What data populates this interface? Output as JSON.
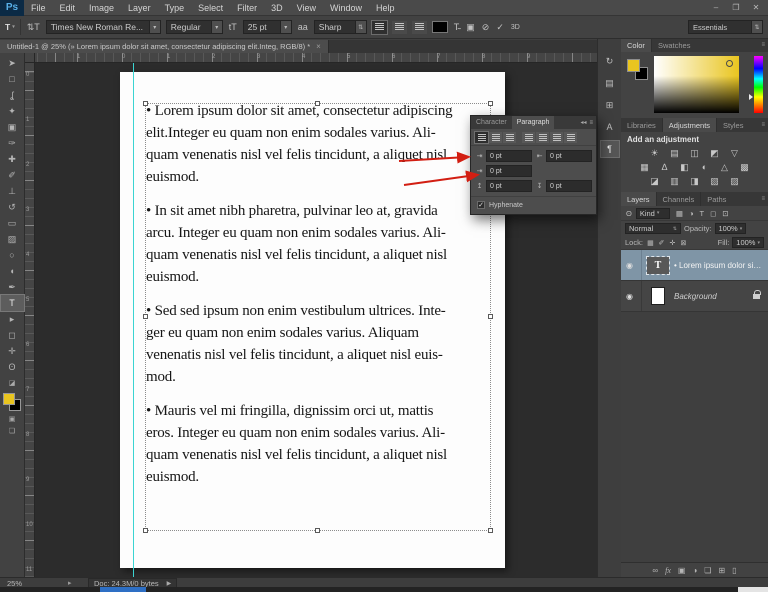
{
  "window": {
    "minimize": "–",
    "restore": "❐",
    "close": "✕"
  },
  "menubar": {
    "logo": "Ps",
    "items": [
      "File",
      "Edit",
      "Image",
      "Layer",
      "Type",
      "Select",
      "Filter",
      "3D",
      "View",
      "Window",
      "Help"
    ]
  },
  "options_bar": {
    "tool_glyph": "T",
    "preset_caret": "▾",
    "orientation_glyph": "⇅T",
    "font_family": "Times New Roman Re...",
    "font_style": "Regular",
    "size_icon": "tT",
    "font_size": "25 pt",
    "aa_icon": "aa",
    "anti_alias": "Sharp",
    "text_color": "#000000",
    "warp_glyph": "T̴",
    "panels_glyph": "▣",
    "cancel_glyph": "⊘",
    "commit_glyph": "✓",
    "threed_glyph": "3D",
    "workspace": "Essentials"
  },
  "document_tab": {
    "title": "Untitled-1 @ 25% (» Lorem ipsum dolor sit amet, consectetur adipiscing elit.Integ, RGB/8) *",
    "close": "×"
  },
  "tools": [
    {
      "name": "move-tool",
      "glyph": "➤"
    },
    {
      "name": "rectangular-marquee-tool",
      "glyph": "□"
    },
    {
      "name": "lasso-tool",
      "glyph": "ʆ"
    },
    {
      "name": "quick-selection-tool",
      "glyph": "✦"
    },
    {
      "name": "crop-tool",
      "glyph": "▣"
    },
    {
      "name": "eyedropper-tool",
      "glyph": "✑"
    },
    {
      "name": "spot-healing-brush-tool",
      "glyph": "✚"
    },
    {
      "name": "brush-tool",
      "glyph": "✐"
    },
    {
      "name": "clone-stamp-tool",
      "glyph": "⊥"
    },
    {
      "name": "history-brush-tool",
      "glyph": "↺"
    },
    {
      "name": "eraser-tool",
      "glyph": "▭"
    },
    {
      "name": "gradient-tool",
      "glyph": "▨"
    },
    {
      "name": "blur-tool",
      "glyph": "○"
    },
    {
      "name": "dodge-tool",
      "glyph": "◖"
    },
    {
      "name": "pen-tool",
      "glyph": "✒"
    },
    {
      "name": "type-tool",
      "glyph": "T",
      "active": true
    },
    {
      "name": "path-selection-tool",
      "glyph": "▸"
    },
    {
      "name": "rectangle-tool",
      "glyph": "◻"
    },
    {
      "name": "hand-tool",
      "glyph": "✛"
    },
    {
      "name": "zoom-tool",
      "glyph": "ʘ"
    }
  ],
  "tool_colors": {
    "foreground": "#e9c51f",
    "background": "#000000"
  },
  "rulers": {
    "horizontal": [
      "1",
      "0",
      "1",
      "2",
      "3",
      "4",
      "5",
      "6",
      "7",
      "8",
      "9"
    ],
    "vertical": [
      "0",
      "1",
      "2",
      "3",
      "4",
      "5",
      "6",
      "7",
      "8",
      "9",
      "10",
      "11"
    ]
  },
  "document": {
    "paragraphs": [
      {
        "lines": [
          "• Lorem ipsum dolor sit amet, consectetur adipiscing",
          "elit.Integer eu quam non enim sodales varius. Ali-",
          "quam venenatis nisl vel felis tincidunt, a aliquet nisl",
          "euismod."
        ]
      },
      {
        "lines": [
          "• In sit amet nibh pharetra, pulvinar leo at, gravida",
          "arcu. Integer eu quam non enim sodales varius. Ali-",
          "quam venenatis nisl vel felis tincidunt, a aliquet nisl",
          "euismod."
        ]
      },
      {
        "lines": [
          "• Sed sed ipsum non enim vestibulum ultrices. Inte-",
          "ger eu quam non enim sodales varius. Aliquam",
          "venenatis nisl vel felis tincidunt, a aliquet nisl euis-",
          "mod."
        ]
      },
      {
        "lines": [
          "• Mauris vel mi fringilla, dignissim orci ut, mattis",
          "eros. Integer eu quam non enim sodales varius. Ali-",
          "quam venenatis nisl vel felis tincidunt, a aliquet nisl",
          "euismod."
        ]
      }
    ]
  },
  "paragraph_panel": {
    "tabs": [
      {
        "label": "Character",
        "active": false
      },
      {
        "label": "Paragraph",
        "active": true
      }
    ],
    "header_icons": "◂◂",
    "menu_icon": "≡",
    "align_buttons": [
      {
        "name": "align-left",
        "pressed": true
      },
      {
        "name": "align-center",
        "pressed": false
      },
      {
        "name": "align-right",
        "pressed": false
      },
      {
        "name": "justify-last-left",
        "pressed": false
      },
      {
        "name": "justify-last-center",
        "pressed": false
      },
      {
        "name": "justify-last-right",
        "pressed": false
      },
      {
        "name": "justify-all",
        "pressed": false
      }
    ],
    "fields": [
      {
        "name": "indent-left-margin",
        "icon": "⇥",
        "value": "0 pt"
      },
      {
        "name": "indent-right-margin",
        "icon": "⇤",
        "value": "0 pt"
      },
      {
        "name": "indent-first-line",
        "icon": "⇥",
        "value": "0 pt"
      },
      {
        "name": "space-before-paragraph",
        "icon": "↥",
        "value": "0 pt"
      },
      {
        "name": "space-after-paragraph",
        "icon": "↧",
        "value": "0 pt"
      }
    ],
    "hyphenate": {
      "label": "Hyphenate",
      "checked": true,
      "check_glyph": "✓"
    }
  },
  "dock_icons": [
    {
      "name": "history-panel-icon",
      "glyph": "↻"
    },
    {
      "name": "preview-panel-icon",
      "glyph": "▤"
    },
    {
      "name": "clone-source-panel-icon",
      "glyph": "⊞"
    },
    {
      "name": "character-panel-icon",
      "glyph": "A"
    },
    {
      "name": "paragraph-panel-icon",
      "glyph": "¶",
      "active": true
    }
  ],
  "color_panel": {
    "tabs": [
      {
        "label": "Color",
        "active": true
      },
      {
        "label": "Swatches",
        "active": false
      }
    ],
    "menu_icon": "≡"
  },
  "adjustments_panel": {
    "tabs": [
      {
        "label": "Libraries",
        "active": false
      },
      {
        "label": "Adjustments",
        "active": true
      },
      {
        "label": "Styles",
        "active": false
      }
    ],
    "menu_icon": "≡",
    "heading": "Add an adjustment",
    "icon_rows": [
      [
        {
          "name": "brightness-contrast-icon",
          "glyph": "☀"
        },
        {
          "name": "levels-icon",
          "glyph": "▤"
        },
        {
          "name": "curves-icon",
          "glyph": "◫"
        },
        {
          "name": "exposure-icon",
          "glyph": "◩"
        },
        {
          "name": "vibrance-icon",
          "glyph": "▽"
        }
      ],
      [
        {
          "name": "hue-saturation-icon",
          "glyph": "▦"
        },
        {
          "name": "color-balance-icon",
          "glyph": "∆"
        },
        {
          "name": "black-white-icon",
          "glyph": "◧"
        },
        {
          "name": "photo-filter-icon",
          "glyph": "◐"
        },
        {
          "name": "channel-mixer-icon",
          "glyph": "△"
        },
        {
          "name": "color-lookup-icon",
          "glyph": "▩"
        }
      ],
      [
        {
          "name": "invert-icon",
          "glyph": "◪"
        },
        {
          "name": "posterize-icon",
          "glyph": "▥"
        },
        {
          "name": "threshold-icon",
          "glyph": "◨"
        },
        {
          "name": "gradient-map-icon",
          "glyph": "▧"
        },
        {
          "name": "selective-color-icon",
          "glyph": "▨"
        }
      ]
    ]
  },
  "layers_panel": {
    "tabs": [
      {
        "label": "Layers",
        "active": true
      },
      {
        "label": "Channels",
        "active": false
      },
      {
        "label": "Paths",
        "active": false
      }
    ],
    "menu_icon": "≡",
    "search_glyph": "ʘ",
    "filter_label": "Kind",
    "filter_caret": "▾",
    "filter_icons": [
      {
        "name": "pixel-layer-filter-icon",
        "glyph": "▦"
      },
      {
        "name": "adjustment-layer-filter-icon",
        "glyph": "◑"
      },
      {
        "name": "type-layer-filter-icon",
        "glyph": "T"
      },
      {
        "name": "shape-layer-filter-icon",
        "glyph": "◻"
      },
      {
        "name": "smart-object-filter-icon",
        "glyph": "⊡"
      }
    ],
    "blend_mode": "Normal",
    "opacity_label": "Opacity:",
    "opacity_value": "100%",
    "lock_label": "Lock:",
    "lock_icons": [
      {
        "name": "lock-transparency-icon",
        "glyph": "▦"
      },
      {
        "name": "lock-pixels-icon",
        "glyph": "✐"
      },
      {
        "name": "lock-position-icon",
        "glyph": "✛"
      },
      {
        "name": "lock-all-icon",
        "glyph": "⊠"
      }
    ],
    "fill_label": "Fill:",
    "fill_value": "100%",
    "eye_glyph": "◉",
    "layers": [
      {
        "name": "• Lorem ipsum dolor sit am...",
        "type": "text",
        "thumb_glyph": "T",
        "selected": true
      },
      {
        "name": "Background",
        "type": "background",
        "locked": true
      }
    ],
    "bottom_icons": [
      {
        "name": "link-layers-icon",
        "glyph": "∞"
      },
      {
        "name": "layer-style-icon",
        "glyph": "fx"
      },
      {
        "name": "add-layer-mask-icon",
        "glyph": "▣"
      },
      {
        "name": "new-adjustment-layer-icon",
        "glyph": "◑"
      },
      {
        "name": "new-group-icon",
        "glyph": "❏"
      },
      {
        "name": "new-layer-icon",
        "glyph": "⊞"
      },
      {
        "name": "delete-layer-icon",
        "glyph": "▯"
      }
    ]
  },
  "status_bar": {
    "zoom": "25%",
    "flyout_glyph": "▸",
    "doc_info": "Doc: 24.3M/0 bytes",
    "expand_glyph": "▶"
  },
  "annotation": {
    "color": "#d21e12"
  }
}
